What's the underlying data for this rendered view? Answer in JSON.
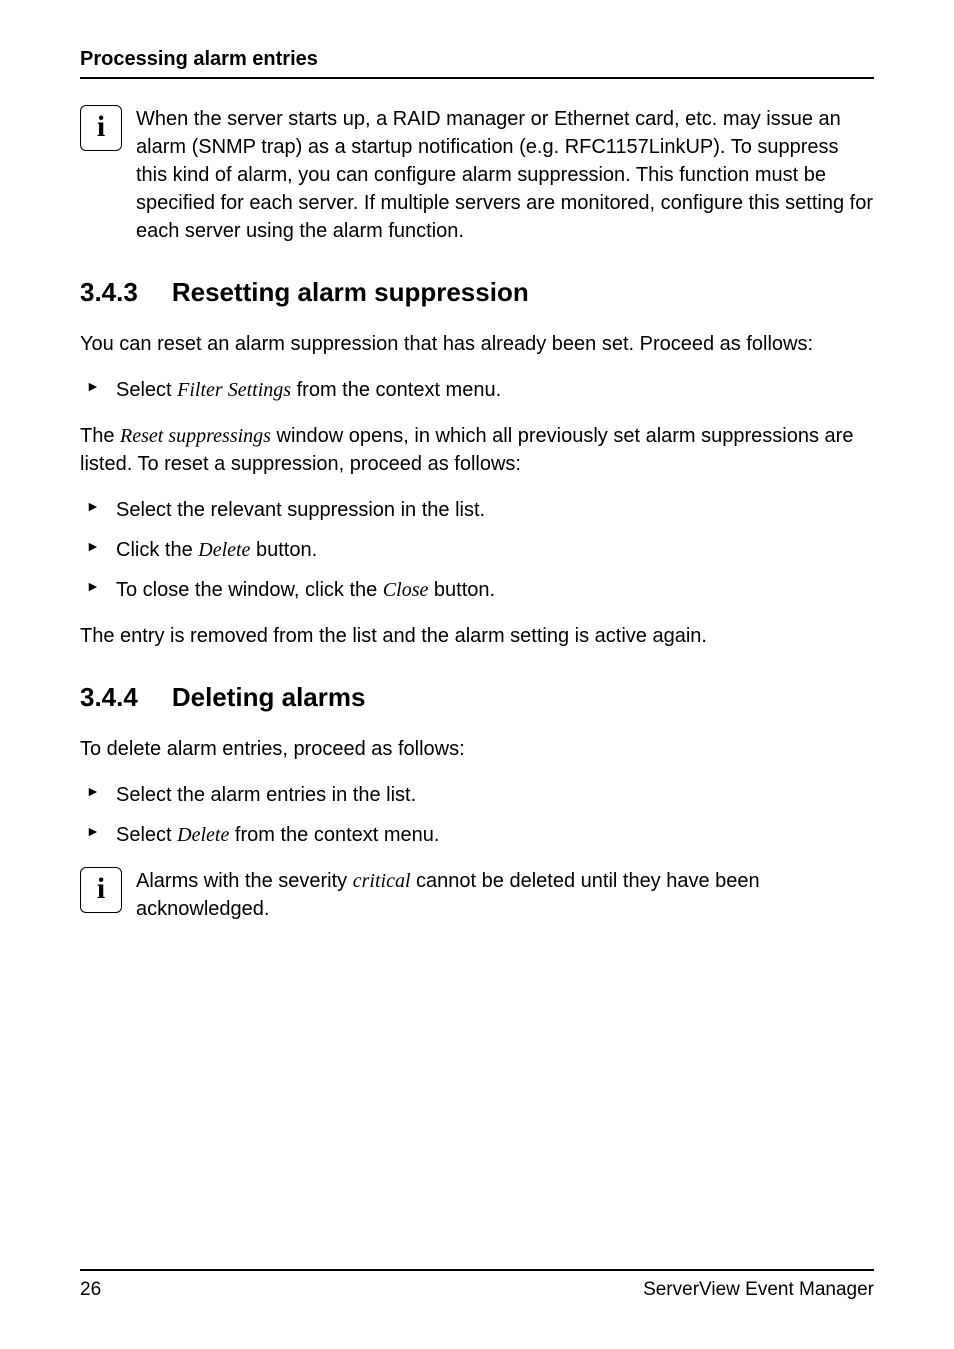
{
  "header": {
    "running": "Processing alarm entries"
  },
  "info1": {
    "text": "When the server starts up, a RAID manager or Ethernet card, etc. may issue an alarm (SNMP trap) as a startup notification (e.g. RFC1157LinkUP). To suppress this kind of alarm, you can configure alarm suppression. This function must be specified for each server. If multiple servers are monitored, configure this setting for each server using the alarm function."
  },
  "section343": {
    "num": "3.4.3",
    "title": "Resetting alarm suppression",
    "intro": "You can reset an alarm suppression that has already been set. Proceed as follows:",
    "step_menu_pre": "Select ",
    "step_menu_italic": "Filter Settings",
    "step_menu_post": " from the context menu.",
    "para2_pre": "The ",
    "para2_italic": "Reset suppressings",
    "para2_post": " window opens, in which all previously set alarm suppressions are listed. To reset a suppression, proceed as follows:",
    "step2": "Select the relevant suppression in the list.",
    "step3_pre": "Click the ",
    "step3_italic": "Delete",
    "step3_post": " button.",
    "step4_pre": "To close the window, click the ",
    "step4_italic": "Close",
    "step4_post": " button.",
    "closing": "The entry is removed from the list and the alarm setting is active again."
  },
  "section344": {
    "num": "3.4.4",
    "title": "Deleting alarms",
    "intro": "To delete alarm entries, proceed as follows:",
    "step1": "Select the alarm entries in the list.",
    "step2_pre": "Select ",
    "step2_italic": "Delete",
    "step2_post": " from the context menu."
  },
  "info2": {
    "pre": "Alarms with the severity ",
    "italic": "critical",
    "post": " cannot be deleted until they have been acknowledged."
  },
  "footer": {
    "page": "26",
    "product": "ServerView Event Manager"
  }
}
